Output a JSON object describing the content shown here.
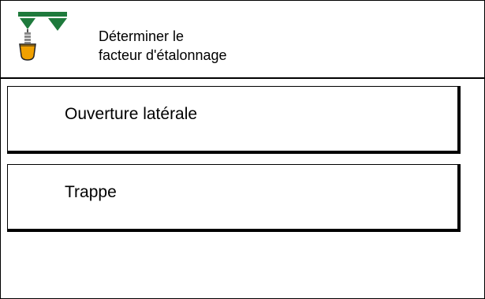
{
  "header": {
    "title_line1": "Déterminer le",
    "title_line2": "facteur d'étalonnage",
    "icon": "fertilizer-spreader-calibration-icon"
  },
  "menu": {
    "items": [
      {
        "label": "Ouverture latérale"
      },
      {
        "label": "Trappe"
      }
    ]
  },
  "colors": {
    "accent_green": "#1e7a3c",
    "accent_orange": "#f0a000",
    "border": "#000000",
    "background": "#ffffff"
  }
}
